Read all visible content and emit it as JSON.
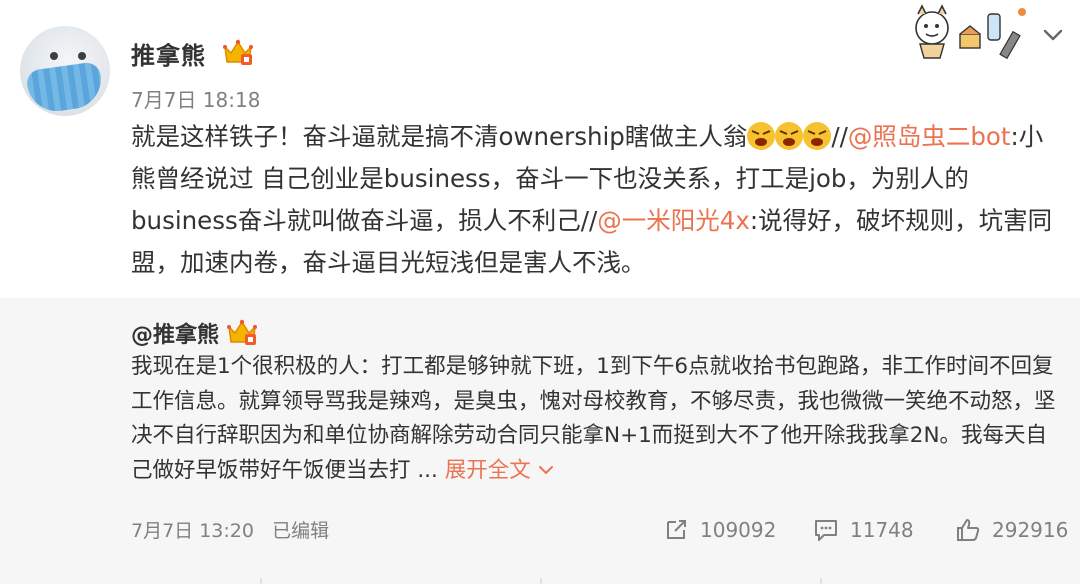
{
  "post": {
    "username": "推拿熊",
    "timestamp": "7月7日 18:18",
    "text_part1": "就是这样铁子！奋斗逼就是搞不清ownership瞎做主人翁",
    "text_sep1": "//",
    "mention1": "@照岛虫二bot",
    "text_part2": ":小熊曾经说过 自己创业是business，奋斗一下也没关系，打工是job，为别人的business奋斗就叫做奋斗逼，损人不利己//",
    "mention2": "@一米阳光4x",
    "text_part3": ":说得好，破坏规则，坑害同盟，加速内卷，奋斗逼目光短浅但是害人不浅。"
  },
  "repost": {
    "username": "@推拿熊",
    "text": "我现在是1个很积极的人：打工都是够钟就下班，1到下午6点就收拾书包跑路，非工作时间不回复工作信息。就算领导骂我是辣鸡，是臭虫，愧对母校教育，不够尽责，我也微微一笑绝不动怒，坚决不自行辞职因为和单位协商解除劳动合同只能拿N+1而挺到大不了他开除我我拿2N。我每天自己做好早饭带好午饭便当去打 ...",
    "expand_label": "展开全文",
    "timestamp": "7月7日 13:20",
    "edited_label": "已编辑",
    "shares": "109092",
    "comments": "11748",
    "likes": "292916"
  },
  "colors": {
    "mention": "#eb7350",
    "meta_gray": "#808080",
    "repost_bg": "#f6f6f6"
  },
  "icons": [
    "avatar-mask",
    "crown-icon",
    "angry-emoji",
    "share-icon",
    "comment-icon",
    "like-icon",
    "chevron-down-icon"
  ]
}
